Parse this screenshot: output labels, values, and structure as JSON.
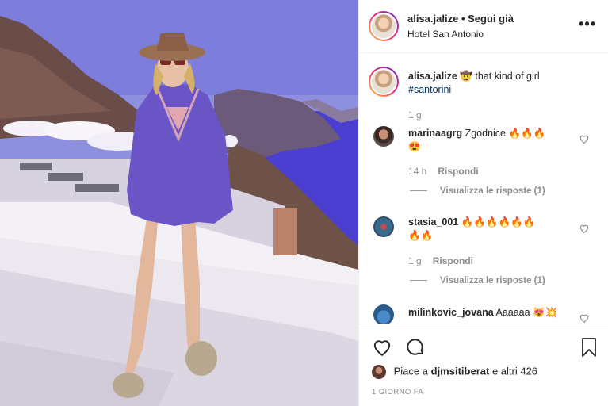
{
  "post": {
    "username": "alisa.jalize",
    "separator": "•",
    "follow_status": "Segui già",
    "location": "Hotel San Antonio"
  },
  "caption": {
    "username": "alisa.jalize",
    "emoji": "🤠",
    "text": "that kind of girl",
    "hashtag": "#santorini",
    "time": "1 g"
  },
  "comments": [
    {
      "username": "marinaagrg",
      "text": "Zgodnice 🔥🔥🔥",
      "text2": "😍",
      "time": "14 h",
      "reply": "Rispondi",
      "view_replies": "Visualizza le risposte (1)"
    },
    {
      "username": "stasia_001",
      "text": "🔥🔥🔥🔥🔥🔥",
      "text2": "🔥🔥",
      "time": "1 g",
      "reply": "Rispondi",
      "view_replies": "Visualizza le risposte (1)"
    },
    {
      "username": "milinkovic_jovana",
      "text": "Aaaaaa 😻💥"
    }
  ],
  "likes": {
    "prefix": "Piace a",
    "user": "djmsitiberat",
    "suffix": "e altri 426"
  },
  "date": "1 GIORNO FA",
  "icons": {
    "more": "more-options-icon",
    "like": "heart-icon",
    "comment": "comment-icon",
    "save": "bookmark-icon"
  },
  "colors": {
    "text": "#262626",
    "muted": "#8e8e8e",
    "hashtag": "#003569",
    "border": "#efefef"
  }
}
